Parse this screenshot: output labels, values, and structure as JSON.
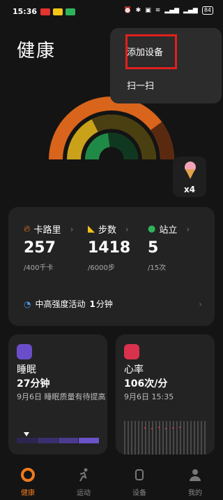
{
  "status_bar": {
    "time": "15:36",
    "battery": "84"
  },
  "page_title": "健康",
  "reward": {
    "count": "x4"
  },
  "stats": [
    {
      "label": "卡路里",
      "value": "257",
      "goal": "/400千卡",
      "color": "#f07a1e",
      "icon": "flame-icon"
    },
    {
      "label": "步数",
      "value": "1418",
      "goal": "/6000步",
      "color": "#f5c518",
      "icon": "shoe-icon"
    },
    {
      "label": "站立",
      "value": "5",
      "goal": "/15次",
      "color": "#2fb35a",
      "icon": "person-icon"
    }
  ],
  "activity": {
    "label": "中高强度活动",
    "value": "1",
    "unit": "分钟"
  },
  "sleep": {
    "title": "睡眠",
    "value": "27分钟",
    "desc": "9月6日 睡眠质量有待提高"
  },
  "heart": {
    "title": "心率",
    "value": "106次/分",
    "desc": "9月6日 15:35"
  },
  "tabs": [
    {
      "label": "健康",
      "active": true
    },
    {
      "label": "运动",
      "active": false
    },
    {
      "label": "设备",
      "active": false
    },
    {
      "label": "我的",
      "active": false
    }
  ],
  "menu": {
    "add_device": "添加设备",
    "scan": "扫一扫"
  },
  "colors": {
    "accent": "#f07a1e",
    "highlight": "#e0201b"
  }
}
